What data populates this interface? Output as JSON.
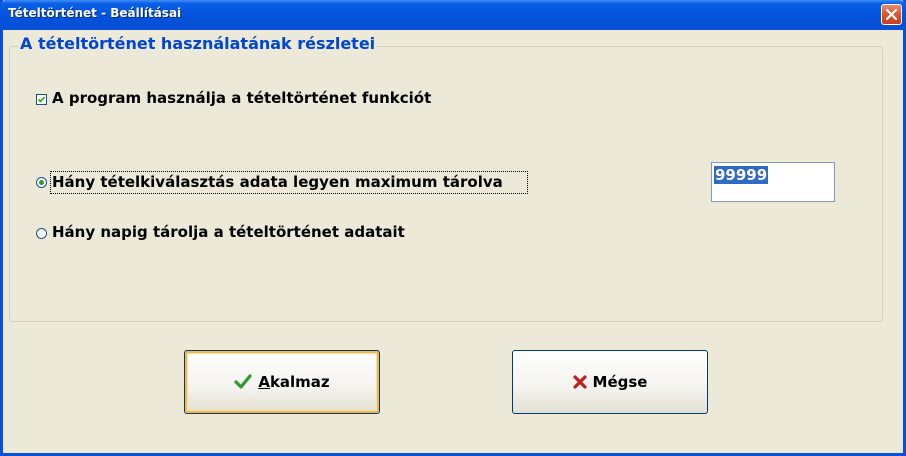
{
  "window": {
    "title": "Tételtörténet - Beállításai"
  },
  "group": {
    "title": "A tételtörténet használatának részletei"
  },
  "options": {
    "use_history": {
      "label": "A program használja a tételtörténet funkciót",
      "checked": true
    },
    "max_selections": {
      "label": "Hány tételkiválasztás adata legyen maximum tárolva",
      "selected": true
    },
    "days_stored": {
      "label": "Hány napig tárolja a tételtörténet adatait",
      "selected": false
    }
  },
  "max_value_input": {
    "value": "99999"
  },
  "buttons": {
    "apply": {
      "mnemonic": "A",
      "rest": "kalmaz",
      "icon": "checkmark-icon",
      "icon_color": "#2e9a2e"
    },
    "cancel": {
      "label": "Mégse",
      "icon": "x-icon",
      "icon_color": "#c0201a"
    }
  },
  "colors": {
    "titlebar": "#0455e0",
    "group_title": "#0046d5",
    "window_bg": "#ece9d8"
  }
}
